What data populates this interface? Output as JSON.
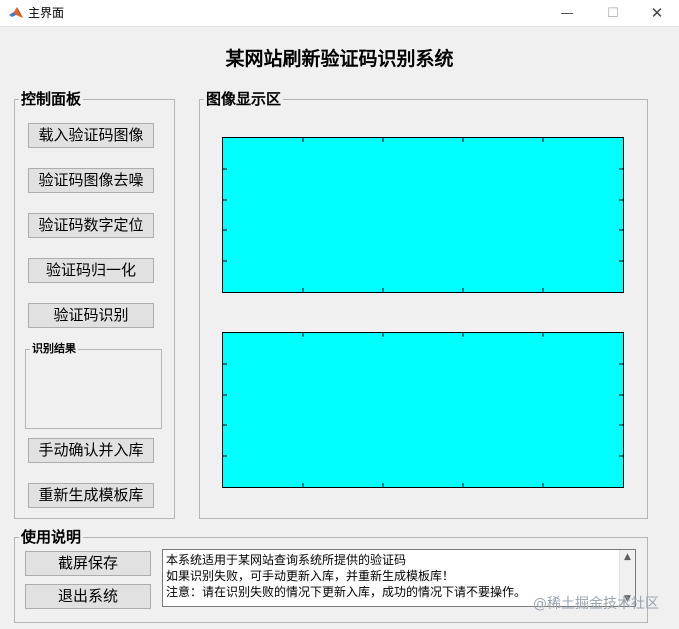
{
  "window": {
    "title": "主界面",
    "minimize_glyph": "—",
    "maximize_glyph": "☐",
    "close_glyph": "✕"
  },
  "main_title": "某网站刷新验证码识别系统",
  "control_panel": {
    "legend": "控制面板",
    "buttons": [
      {
        "label": "载入验证码图像"
      },
      {
        "label": "验证码图像去噪"
      },
      {
        "label": "验证码数字定位"
      },
      {
        "label": "验证码归一化"
      },
      {
        "label": "验证码识别"
      }
    ],
    "result_legend": "识别结果",
    "result_value": "",
    "confirm_button": "手动确认并入库",
    "regen_button": "重新生成模板库"
  },
  "display_panel": {
    "legend": "图像显示区",
    "axes_color": "#00ffff"
  },
  "usage_panel": {
    "legend": "使用说明",
    "screenshot_button": "截屏保存",
    "exit_button": "退出系统",
    "info_lines": [
      "本系统适用于某网站查询系统所提供的验证码",
      "如果识别失败，可手动更新入库，并重新生成模板库！",
      "注意：请在识别失败的情况下更新入库，成功的情况下请不要操作。"
    ]
  },
  "watermark": "@稀土掘金技术社区"
}
